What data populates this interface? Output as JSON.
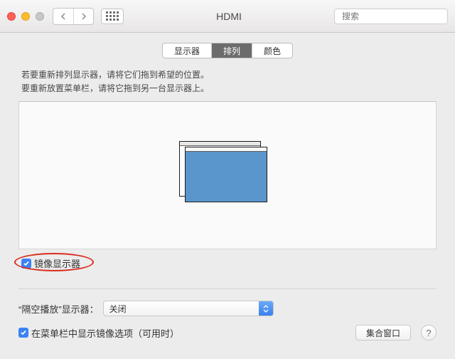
{
  "window": {
    "title": "HDMI"
  },
  "search": {
    "placeholder": "搜索"
  },
  "tabs": {
    "display": "显示器",
    "arrange": "排列",
    "color": "颜色"
  },
  "instructions": {
    "line1": "若要重新排列显示器，请将它们拖到希望的位置。",
    "line2": "要重新放置菜单栏，请将它拖到另一台显示器上。"
  },
  "mirror": {
    "label": "镜像显示器"
  },
  "airplay": {
    "label": "“隔空播放”显示器：",
    "value": "关闭"
  },
  "bottom": {
    "menubar_label": "在菜单栏中显示镜像选项（可用时）",
    "gather": "集合窗口",
    "help": "?"
  }
}
